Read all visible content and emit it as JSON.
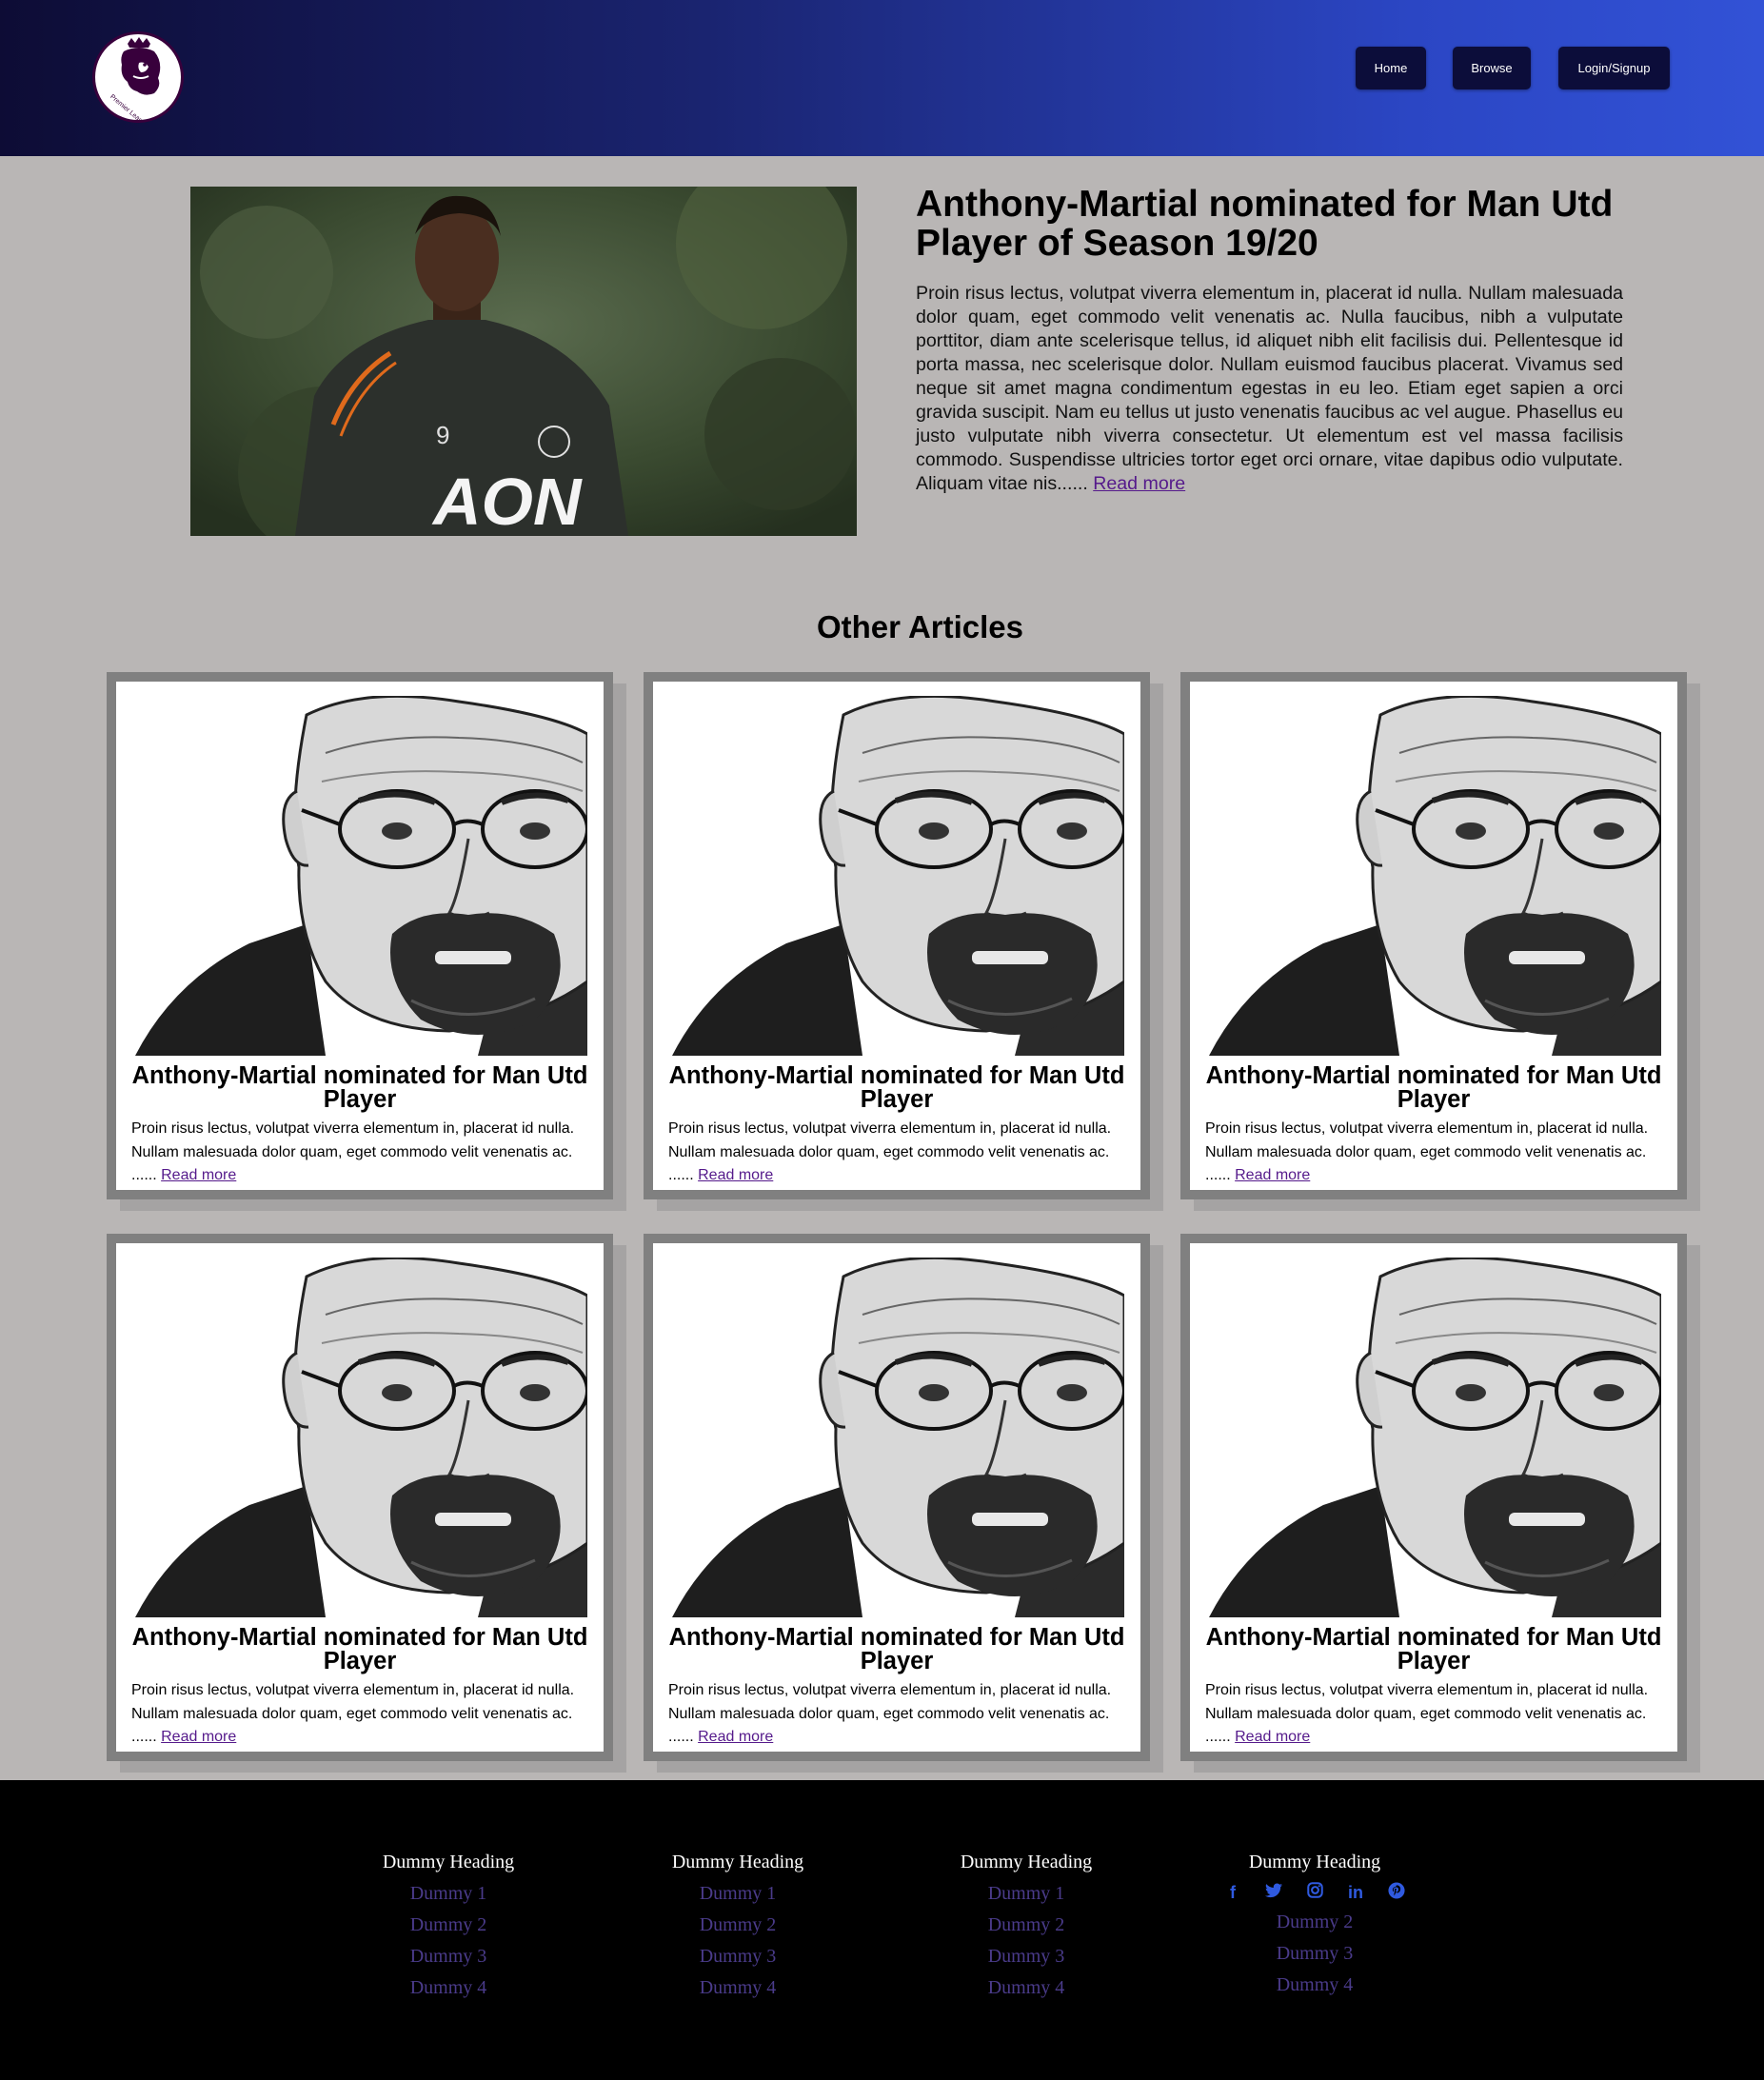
{
  "nav": {
    "items": [
      {
        "label": "Home"
      },
      {
        "label": "Browse"
      },
      {
        "label": "Login/Signup"
      }
    ]
  },
  "logo": {
    "text": "Premier League"
  },
  "featured": {
    "title": "Anthony-Martial nominated for Man Utd Player of Season 19/20",
    "body": "Proin risus lectus, volutpat viverra elementum in, placerat id nulla. Nullam malesuada dolor quam, eget commodo velit venenatis ac. Nulla faucibus, nibh a vulputate porttitor, diam ante scelerisque tellus, id aliquet nibh elit facilisis dui. Pellentesque id porta massa, nec scelerisque dolor. Nullam euismod faucibus placerat. Vivamus sed neque sit amet magna condimentum egestas in eu leo. Etiam eget sapien a orci gravida suscipit. Nam eu tellus ut justo venenatis faucibus ac vel augue. Phasellus eu justo vulputate nibh viverra consectetur. Ut elementum est vel massa facilisis commodo. Suspendisse ultricies tortor eget orci ornare, vitae dapibus odio vulputate. Aliquam vitae nis......",
    "read_more": "Read more",
    "shirt_text": "AON",
    "shirt_number": "9"
  },
  "other_articles": {
    "heading": "Other Articles",
    "cards": [
      {
        "title": "Anthony-Martial nominated for Man Utd Player",
        "body": "Proin risus lectus, volutpat viverra elementum in, placerat id nulla. Nullam malesuada dolor quam, eget commodo velit venenatis ac. ......",
        "read_more": "Read more"
      },
      {
        "title": "Anthony-Martial nominated for Man Utd Player",
        "body": "Proin risus lectus, volutpat viverra elementum in, placerat id nulla. Nullam malesuada dolor quam, eget commodo velit venenatis ac. ......",
        "read_more": "Read more"
      },
      {
        "title": "Anthony-Martial nominated for Man Utd Player",
        "body": "Proin risus lectus, volutpat viverra elementum in, placerat id nulla. Nullam malesuada dolor quam, eget commodo velit venenatis ac. ......",
        "read_more": "Read more"
      },
      {
        "title": "Anthony-Martial nominated for Man Utd Player",
        "body": "Proin risus lectus, volutpat viverra elementum in, placerat id nulla. Nullam malesuada dolor quam, eget commodo velit venenatis ac. ......",
        "read_more": "Read more"
      },
      {
        "title": "Anthony-Martial nominated for Man Utd Player",
        "body": "Proin risus lectus, volutpat viverra elementum in, placerat id nulla. Nullam malesuada dolor quam, eget commodo velit venenatis ac. ......",
        "read_more": "Read more"
      },
      {
        "title": "Anthony-Martial nominated for Man Utd Player",
        "body": "Proin risus lectus, volutpat viverra elementum in, placerat id nulla. Nullam malesuada dolor quam, eget commodo velit venenatis ac. ......",
        "read_more": "Read more"
      }
    ]
  },
  "footer": {
    "columns": [
      {
        "heading": "Dummy Heading",
        "items": [
          "Dummy 1",
          "Dummy 2",
          "Dummy 3",
          "Dummy 4"
        ]
      },
      {
        "heading": "Dummy Heading",
        "items": [
          "Dummy 1",
          "Dummy 2",
          "Dummy 3",
          "Dummy 4"
        ]
      },
      {
        "heading": "Dummy Heading",
        "items": [
          "Dummy 1",
          "Dummy 2",
          "Dummy 3",
          "Dummy 4"
        ]
      },
      {
        "heading": "Dummy Heading",
        "social": [
          "facebook-icon",
          "twitter-icon",
          "instagram-icon",
          "linkedin-icon",
          "pinterest-icon"
        ],
        "items": [
          "Dummy 2",
          "Dummy 3",
          "Dummy 4"
        ]
      }
    ]
  },
  "colors": {
    "page_bg": "#b9b6b5",
    "header_gradient_start": "#0d0c35",
    "header_gradient_end": "#3252d6",
    "nav_button_bg": "#0c0d3a",
    "card_border": "#808080",
    "footer_bg": "#000000",
    "footer_link": "#4a3b8a",
    "social_icon": "#2f5ae0",
    "link": "#551a8b"
  }
}
